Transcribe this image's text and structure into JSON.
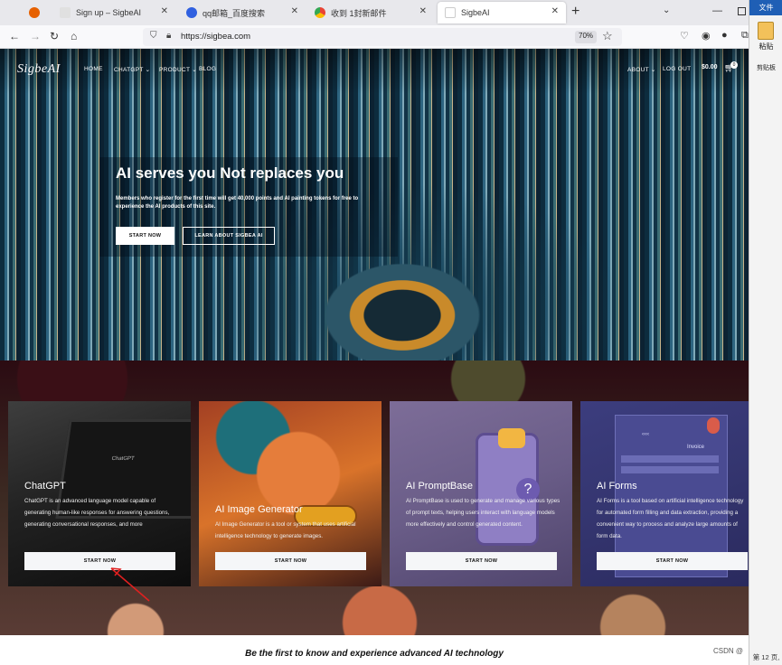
{
  "browser": {
    "tabs": [
      {
        "label": "",
        "favicon_color": "#e66000"
      },
      {
        "label": "Sign up – SigbeAI",
        "favicon_color": "#dddddd"
      },
      {
        "label": "qq邮箱_百度搜索",
        "favicon_color": "#3060e0"
      },
      {
        "label": "收到 1封新邮件",
        "favicon_color": "#34a853"
      },
      {
        "label": "SigbeAI",
        "favicon_color": "#ffffff"
      }
    ],
    "url": "https://sigbea.com",
    "zoom": "70%"
  },
  "side_panel": {
    "file_label": "文件",
    "paste_label": "粘贴",
    "clipboard_label": "剪贴板",
    "page_label": "第 12 页,"
  },
  "site": {
    "logo": "SigbeAI",
    "nav": {
      "home": "HOME",
      "chatgpt": "CHATGPT",
      "product": "PRODUCT",
      "blog": "BLOG",
      "about": "ABOUT",
      "logout": "LOG OUT"
    },
    "cart": {
      "total": "$0.00",
      "count": "0"
    }
  },
  "hero": {
    "title": "AI serves you Not replaces you",
    "subtitle": "Members who register for the first time will get 40,000 points and AI painting tokens for free to experience the AI products of this site.",
    "start_button": "START NOW",
    "learn_button": "LEARN ABOUT SIGBEA AI"
  },
  "cards": [
    {
      "title": "ChatGPT",
      "desc": "ChatGPT is an advanced language model capable of generating human-like responses for answering questions, generating conversational responses, and more",
      "button": "START NOW"
    },
    {
      "title": "AI Image Generator",
      "desc": "AI Image Generator is a tool or system that uses artificial intelligence technology to generate images.",
      "button": "START NOW"
    },
    {
      "title": "AI PromptBase",
      "desc": "AI PromptBase is used to generate and manage various types of prompt texts, helping users interact with language models more effectively and control generated content.",
      "button": "START NOW"
    },
    {
      "title": "AI Forms",
      "desc": "AI Forms is a tool based on artificial intelligence technology for automated form filling and data extraction, providing a convenient way to process and analyze large amounts of form data.",
      "button": "START NOW"
    }
  ],
  "card_art": {
    "chatgpt_screen_text": "ChatGPT",
    "forms_heading": "Invoice",
    "forms_arrows": "‹‹‹‹"
  },
  "tagline": "Be the first to know and experience advanced AI technology",
  "watermark": "CSDN @"
}
